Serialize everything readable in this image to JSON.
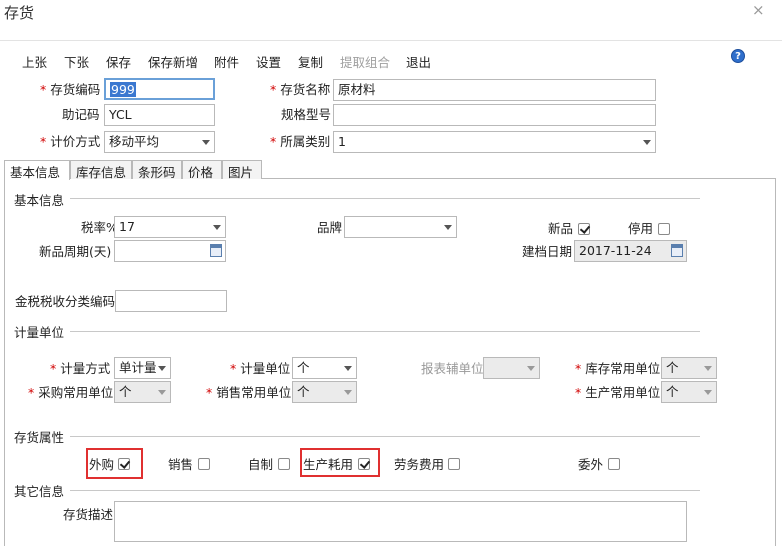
{
  "window": {
    "title": "存货",
    "close_glyph": "×"
  },
  "toolbar": {
    "items": [
      "上张",
      "下张",
      "保存",
      "保存新增",
      "附件",
      "设置",
      "复制",
      "提取组合",
      "退出"
    ],
    "help_glyph": "?"
  },
  "header": {
    "code": {
      "label": "存货编码",
      "value": "999"
    },
    "name": {
      "label": "存货名称",
      "value": "原材料"
    },
    "mnemonic": {
      "label": "助记码",
      "value": "YCL"
    },
    "spec": {
      "label": "规格型号",
      "value": ""
    },
    "valuation": {
      "label": "计价方式",
      "value": "移动平均"
    },
    "category": {
      "label": "所属类别",
      "value": "1"
    },
    "required_mark": "*"
  },
  "tabs": [
    {
      "label": "基本信息",
      "active": true
    },
    {
      "label": "库存信息",
      "active": false
    },
    {
      "label": "条形码",
      "active": false
    },
    {
      "label": "价格",
      "active": false
    },
    {
      "label": "图片",
      "active": false
    }
  ],
  "basic": {
    "section": "基本信息",
    "tax_rate": {
      "label": "税率%",
      "value": "17"
    },
    "brand": {
      "label": "品牌",
      "value": ""
    },
    "new_product": {
      "label": "新品",
      "checked": true
    },
    "disabled": {
      "label": "停用",
      "checked": false
    },
    "new_period": {
      "label": "新品周期(天)",
      "value": ""
    },
    "created_date": {
      "label": "建档日期",
      "value": "2017-11-24"
    },
    "tax_code": {
      "label": "金税税收分类编码",
      "value": ""
    }
  },
  "units": {
    "section": "计量单位",
    "method": {
      "label": "计量方式",
      "value": "单计量"
    },
    "unit": {
      "label": "计量单位",
      "value": "个"
    },
    "report_aux": {
      "label": "报表辅单位",
      "value": ""
    },
    "stock_unit": {
      "label": "库存常用单位",
      "value": "个"
    },
    "purchase_unit": {
      "label": "采购常用单位",
      "value": "个"
    },
    "sales_unit": {
      "label": "销售常用单位",
      "value": "个"
    },
    "production_unit": {
      "label": "生产常用单位",
      "value": "个"
    }
  },
  "attributes": {
    "section": "存货属性",
    "items": [
      {
        "label": "外购",
        "checked": true,
        "highlighted": true
      },
      {
        "label": "销售",
        "checked": false,
        "highlighted": false
      },
      {
        "label": "自制",
        "checked": false,
        "highlighted": false
      },
      {
        "label": "生产耗用",
        "checked": true,
        "highlighted": true
      },
      {
        "label": "劳务费用",
        "checked": false,
        "highlighted": false
      },
      {
        "label": "委外",
        "checked": false,
        "highlighted": false
      }
    ]
  },
  "other": {
    "section": "其它信息",
    "description": {
      "label": "存货描述",
      "value": ""
    }
  },
  "colors": {
    "required": "#d10000",
    "highlight_box": "#e03030",
    "help_icon": "#2f6fcc"
  }
}
